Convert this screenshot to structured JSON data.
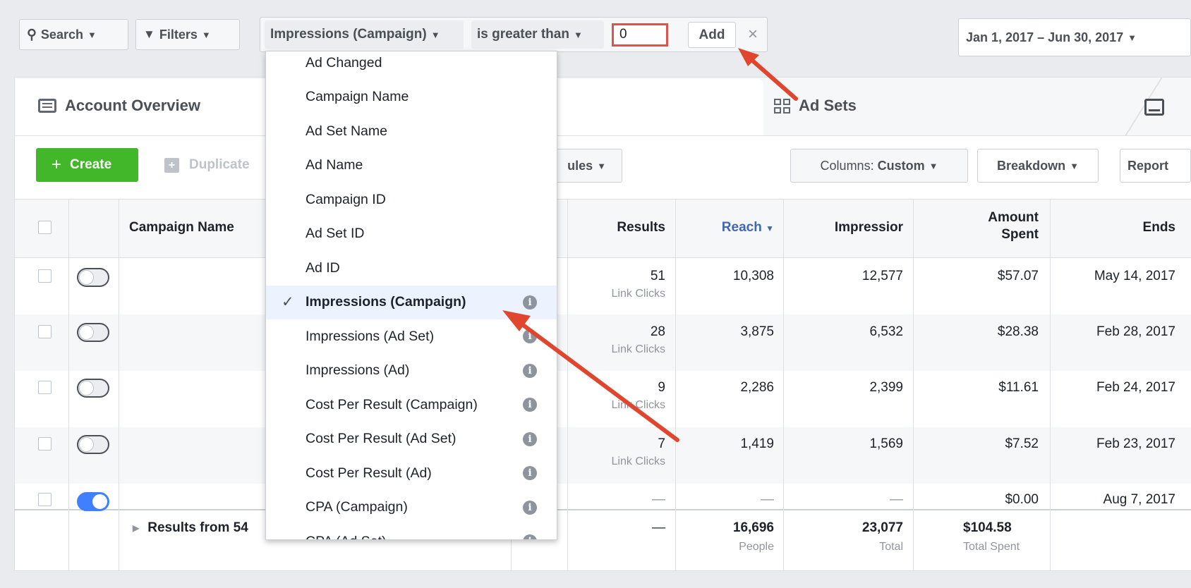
{
  "toolbar": {
    "search_label": "Search",
    "filters_label": "Filters",
    "field_label": "Impressions (Campaign)",
    "operator_label": "is greater than",
    "value": "0",
    "add_label": "Add",
    "date_range": "Jan 1, 2017 – Jun 30, 2017"
  },
  "tabs": {
    "account_overview": "Account Overview",
    "ad_sets": "Ad Sets"
  },
  "actions": {
    "create_label": "Create",
    "duplicate_label": "Duplicate",
    "rules_label": "ules",
    "columns_prefix": "Columns: ",
    "columns_value": "Custom",
    "breakdown_label": "Breakdown",
    "reports_label": "Report"
  },
  "table": {
    "headers": {
      "campaign_name": "Campaign Name",
      "results": "Results",
      "reach": "Reach",
      "impressions": "Impressior",
      "amount_spent_1": "Amount",
      "amount_spent_2": "Spent",
      "ends": "Ends"
    },
    "rows": [
      {
        "results": "51",
        "results_sub": "Link Clicks",
        "reach": "10,308",
        "impressions": "12,577",
        "spent": "$57.07",
        "ends": "May 14, 2017",
        "active": false
      },
      {
        "results": "28",
        "results_sub": "Link Clicks",
        "reach": "3,875",
        "impressions": "6,532",
        "spent": "$28.38",
        "ends": "Feb 28, 2017",
        "active": false
      },
      {
        "results": "9",
        "results_sub": "Link Clicks",
        "reach": "2,286",
        "impressions": "2,399",
        "spent": "$11.61",
        "ends": "Feb 24, 2017",
        "active": false
      },
      {
        "results": "7",
        "results_sub": "Link Clicks",
        "reach": "1,419",
        "impressions": "1,569",
        "spent": "$7.52",
        "ends": "Feb 23, 2017",
        "active": false
      },
      {
        "results": "—",
        "results_sub": "",
        "reach": "—",
        "impressions": "—",
        "spent": "$0.00",
        "ends": "Aug 7, 2017",
        "active": true
      }
    ],
    "totals": {
      "label": "Results from 54",
      "results": "—",
      "reach": "16,696",
      "reach_sub": "People",
      "impressions": "23,077",
      "impressions_sub": "Total",
      "spent": "$104.58",
      "spent_sub": "Total Spent"
    }
  },
  "dropdown": {
    "items": [
      "Ad Changed",
      "Campaign Name",
      "Ad Set Name",
      "Ad Name",
      "Campaign ID",
      "Ad Set ID",
      "Ad ID",
      "Impressions (Campaign)",
      "Impressions (Ad Set)",
      "Impressions (Ad)",
      "Cost Per Result (Campaign)",
      "Cost Per Result (Ad Set)",
      "Cost Per Result (Ad)",
      "CPA (Campaign)",
      "CPA (Ad Set)"
    ],
    "selected_index": 7
  },
  "colors": {
    "accent_blue": "#4080ff",
    "create_green": "#42b72a",
    "annotation_red": "#e0452e"
  }
}
